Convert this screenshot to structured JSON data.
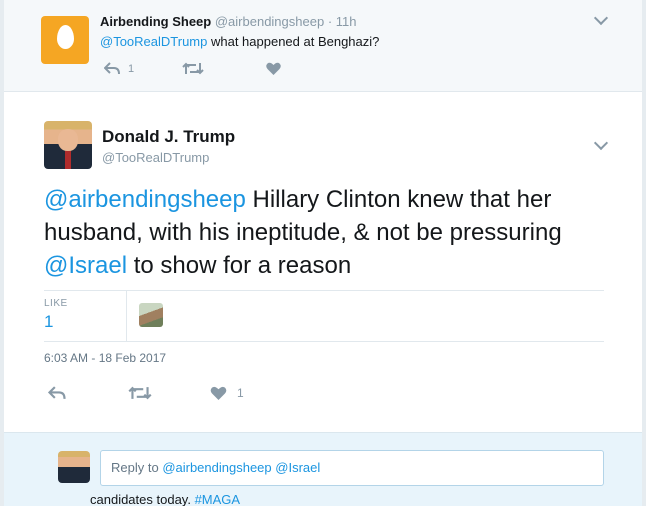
{
  "parent_tweet": {
    "name": "Airbending Sheep",
    "handle": "@airbendingsheep",
    "time": "· 11h",
    "mention": "@TooRealDTrump",
    "text": " what happened at Benghazi?",
    "reply_count": "1",
    "avatar_icon": "egg-icon"
  },
  "main_tweet": {
    "name": "Donald J. Trump",
    "handle": "@TooRealDTrump",
    "text_parts": {
      "mention1": "@airbendingsheep",
      "body1": " Hillary Clinton knew that her husband, with his ineptitude, & not be pressuring ",
      "mention2": "@Israel",
      "body2": " to show for a reason"
    },
    "likes_label": "LIKE",
    "likes_count": "1",
    "timestamp": "6:03 AM - 18 Feb 2017",
    "like_action_count": "1"
  },
  "reply_box": {
    "prefix": "Reply to ",
    "mention1": "@airbendingsheep",
    "mention2": "@Israel"
  },
  "underlying": {
    "text": "candidates today. ",
    "hashtag": "#MAGA"
  },
  "colors": {
    "link": "#1b95e0",
    "muted": "#8899a6",
    "egg": "#f5a623"
  }
}
